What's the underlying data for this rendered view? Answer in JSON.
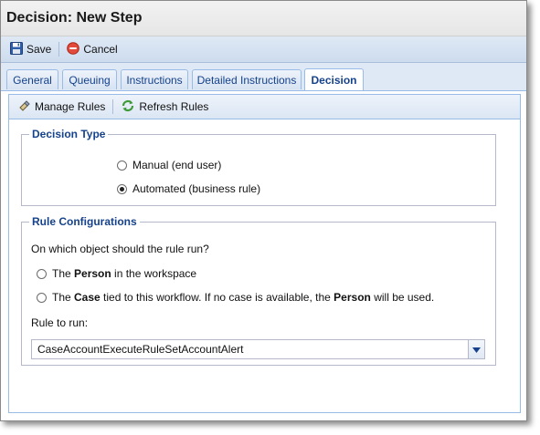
{
  "window": {
    "title": "Decision: New Step"
  },
  "toolbar": {
    "save_label": "Save",
    "cancel_label": "Cancel"
  },
  "tabs": [
    {
      "label": "General"
    },
    {
      "label": "Queuing"
    },
    {
      "label": "Instructions"
    },
    {
      "label": "Detailed Instructions"
    },
    {
      "label": "Decision"
    }
  ],
  "active_tab": "Decision",
  "rules_bar": {
    "manage_label": "Manage Rules",
    "refresh_label": "Refresh Rules"
  },
  "decision_type": {
    "legend": "Decision Type",
    "options": [
      {
        "label": "Manual (end user)",
        "selected": false
      },
      {
        "label": "Automated (business rule)",
        "selected": true
      }
    ]
  },
  "rule_config": {
    "legend": "Rule Configurations",
    "question": "On which object should the rule run?",
    "option_person": {
      "pre": "The ",
      "bold": "Person",
      "post": " in the workspace",
      "selected": false
    },
    "option_case": {
      "pre": "The ",
      "bold": "Case",
      "mid": " tied to this workflow. If no case is available, the ",
      "bold2": "Person",
      "post": " will be used.",
      "selected": false
    },
    "rule_label": "Rule to run:",
    "rule_value": "CaseAccountExecuteRuleSetAccountAlert"
  },
  "colors": {
    "accent": "#15428b",
    "toolbar": "#cddcee",
    "border": "#99bbe8"
  }
}
